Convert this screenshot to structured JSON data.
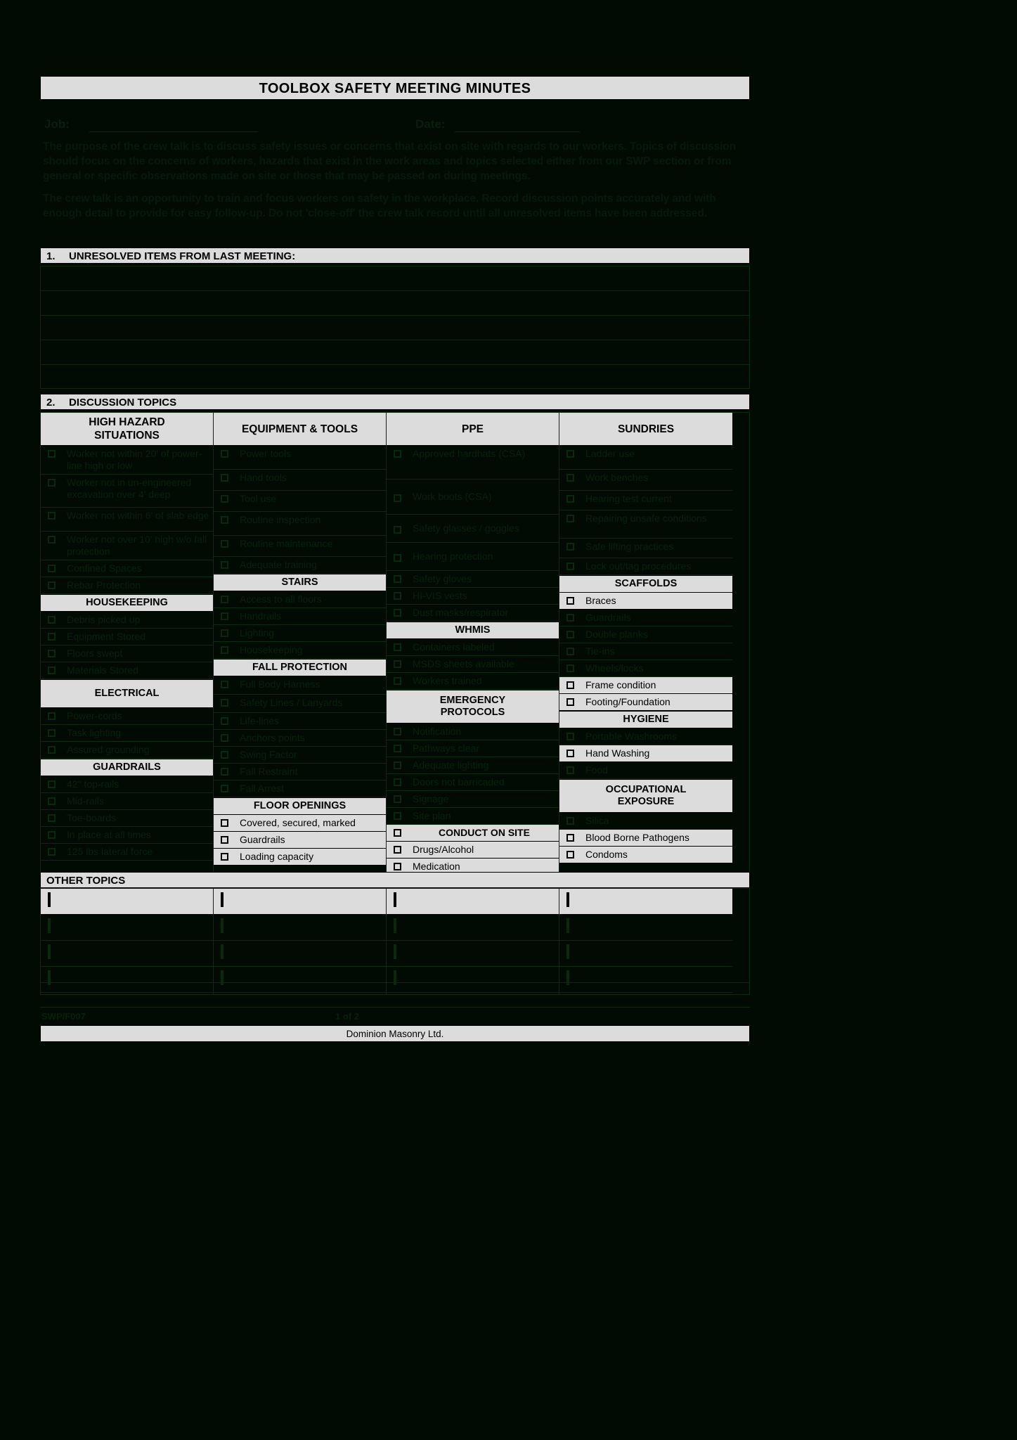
{
  "document": {
    "title": "TOOLBOX SAFETY MEETING MINUTES",
    "job_label": "Job:",
    "date_label": "Date:",
    "job_value": "",
    "date_value": "",
    "intro_paragraph_1": "The purpose of the crew talk is to discuss safety issues or concerns that exist on site with regards to our workers.  Topics of discussion should focus on the concerns of workers, hazards that exist in the work areas and topics selected either from our SWP section or from general or specific observations made on site or those that may be passed on during meetings.",
    "intro_paragraph_2": "The crew talk is an opportunity to train and focus workers on safety in the workplace.  Record discussion points accurately and with enough detail to provide for easy follow-up.  Do not 'close-off' the crew talk record until all unresolved items have been addressed."
  },
  "section1": {
    "number": "1.",
    "title": "UNRESOLVED ITEMS FROM LAST MEETING:",
    "blank_lines": 5
  },
  "section2": {
    "number": "2.",
    "title": "DISCUSSION TOPICS",
    "columns": [
      {
        "header": "HIGH HAZARD\nSITUATIONS",
        "header_line1": "HIGH HAZARD",
        "header_line2": "SITUATIONS",
        "groups": [
          {
            "heading": null,
            "items": [
              "Worker not within 20' of power-line high or low",
              "Worker not in un-engineered excavation over 4' deep",
              "Worker not within 6' of slab edge",
              "Worker not over 10' high w/o fall protection",
              "Confined Spaces",
              "Rebar Protection"
            ]
          },
          {
            "heading": "HOUSEKEEPING",
            "items": [
              "Debris picked up",
              "Equipment Stored",
              "Floors swept",
              "Materials Stored"
            ]
          },
          {
            "heading": "ELECTRICAL",
            "items": [
              "Power-cords",
              "Task lighting",
              "Assured grounding"
            ]
          },
          {
            "heading": "GUARDRAILS",
            "items": [
              "42\" top-rails",
              "Mid-rails",
              "Toe-boards",
              "In place at all times",
              "125 lbs lateral force"
            ]
          }
        ]
      },
      {
        "header": "EQUIPMENT & TOOLS",
        "header_line1": "EQUIPMENT & TOOLS",
        "header_line2": "",
        "groups": [
          {
            "heading": null,
            "items": [
              "Power tools",
              "Hand tools",
              "Tool use",
              "Routine inspection",
              "Routine maintenance",
              "Adequate training"
            ]
          },
          {
            "heading": "STAIRS",
            "items": [
              "Access to all floors",
              "Handrails",
              "Lighting",
              "Housekeeping"
            ]
          },
          {
            "heading": "FALL PROTECTION",
            "items": [
              "Full Body Harness",
              "Safety Lines / Lanyards",
              "Life-lines",
              "Anchors points",
              "Swing Factor",
              "Fall Restraint",
              "Fall Arrest"
            ]
          },
          {
            "heading": "FLOOR OPENINGS",
            "visible": true,
            "items": [
              "Covered, secured, marked",
              "Guardrails",
              "Loading capacity"
            ]
          }
        ]
      },
      {
        "header": "PPE",
        "header_line1": "PPE",
        "header_line2": "",
        "groups": [
          {
            "heading": null,
            "items": [
              "Approved hardhats (CSA)",
              "Work boots (CSA)",
              "Safety glasses / goggles",
              "Hearing protection",
              "Safety gloves",
              "HI-VIS vests",
              "Dust masks/respirator"
            ]
          },
          {
            "heading": "WHMIS",
            "items": [
              "Containers labeled",
              "MSDS sheets available",
              "Workers trained"
            ]
          },
          {
            "heading": "EMERGENCY PROTOCOLS",
            "heading_line1": "EMERGENCY",
            "heading_line2": "PROTOCOLS",
            "items": [
              "Notification",
              "Pathways clear",
              "Adequate lighting",
              "Doors not barricaded",
              "Signage",
              "Site plan"
            ]
          },
          {
            "heading": "CONDUCT ON SITE",
            "visible": true,
            "heading_inline": true,
            "items": [
              "Drugs/Alcohol",
              "Medication"
            ]
          }
        ]
      },
      {
        "header": "SUNDRIES",
        "header_line1": "SUNDRIES",
        "header_line2": "",
        "groups": [
          {
            "heading": null,
            "items": [
              "Ladder use",
              "Work benches",
              "Hearing test current",
              "Repairing unsafe conditions",
              "Safe lifting practices",
              "Lock out/tag procedures"
            ]
          },
          {
            "heading": "SCAFFOLDS",
            "items": [
              "Braces",
              "Guardrails",
              "Double planks",
              "Tie-ins",
              "Wheels/locks",
              "Frame condition",
              "Footing/Foundation"
            ]
          },
          {
            "heading": "HYGIENE",
            "items": [
              "Portable Washrooms",
              "Hand Washing",
              "Food"
            ]
          },
          {
            "heading": "OCCUPATIONAL EXPOSURE",
            "heading_line1": "OCCUPATIONAL",
            "heading_line2": "EXPOSURE",
            "items": [
              "Silica",
              "Blood Borne Pathogens",
              "Condoms"
            ]
          }
        ]
      }
    ]
  },
  "other_topics": {
    "title": "OTHER TOPICS",
    "rows": 4,
    "columns": 4
  },
  "footer": {
    "left": "SWP/F007",
    "middle": "1 of 2",
    "company": "Dominion Masonry Ltd."
  },
  "colors": {
    "page_background": "#020b03",
    "band_background": "#dcdcdc",
    "band_text": "#000000",
    "hidden_text": "#07210b",
    "border": "#0c2a10"
  }
}
